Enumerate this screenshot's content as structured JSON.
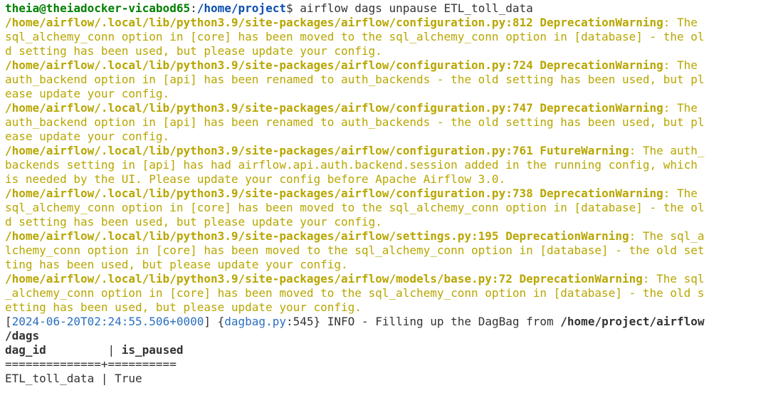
{
  "prompt": {
    "user_host": "theia@theiadocker-vicabod65",
    "sep": ":",
    "path": "/home/project",
    "symbol": "$ ",
    "command": "airflow dags unpause ETL_toll_data"
  },
  "warnings": [
    {
      "first": {
        "path": "/home/airflow/.local/lib/python3.9/site-packages/airflow/configuration.py:812",
        "type": "DeprecationWarning",
        "rest": ": The"
      },
      "lines": [
        "sql_alchemy_conn option in [core] has been moved to the sql_alchemy_conn option in [database] - the ol",
        "d setting has been used, but please update your config."
      ]
    },
    {
      "first": {
        "path": "/home/airflow/.local/lib/python3.9/site-packages/airflow/configuration.py:724",
        "type": "DeprecationWarning",
        "rest": ": The"
      },
      "lines": [
        "auth_backend option in [api] has been renamed to auth_backends - the old setting has been used, but pl",
        "ease update your config."
      ]
    },
    {
      "first": {
        "path": "/home/airflow/.local/lib/python3.9/site-packages/airflow/configuration.py:747",
        "type": "DeprecationWarning",
        "rest": ": The"
      },
      "lines": [
        "auth_backend option in [api] has been renamed to auth_backends - the old setting has been used, but pl",
        "ease update your config."
      ]
    },
    {
      "first": {
        "path": "/home/airflow/.local/lib/python3.9/site-packages/airflow/configuration.py:761",
        "type": "FutureWarning",
        "rest": ": The auth_"
      },
      "lines": [
        "backends setting in [api] has had airflow.api.auth.backend.session added in the running config, which",
        "is needed by the UI. Please update your config before Apache Airflow 3.0."
      ]
    },
    {
      "first": {
        "path": "/home/airflow/.local/lib/python3.9/site-packages/airflow/configuration.py:738",
        "type": "DeprecationWarning",
        "rest": ": The"
      },
      "lines": [
        "sql_alchemy_conn option in [core] has been moved to the sql_alchemy_conn option in [database] - the ol",
        "d setting has been used, but please update your config."
      ]
    },
    {
      "first": {
        "path": "/home/airflow/.local/lib/python3.9/site-packages/airflow/settings.py:195",
        "type": "DeprecationWarning",
        "rest": ": The sql_a"
      },
      "lines": [
        "lchemy_conn option in [core] has been moved to the sql_alchemy_conn option in [database] - the old set",
        "ting has been used, but please update your config."
      ]
    },
    {
      "first": {
        "path": "/home/airflow/.local/lib/python3.9/site-packages/airflow/models/base.py:72",
        "type": "DeprecationWarning",
        "rest": ": The sql"
      },
      "lines": [
        "_alchemy_conn option in [core] has been moved to the sql_alchemy_conn option in [database] - the old s",
        "etting has been used, but please update your config."
      ]
    }
  ],
  "info": {
    "open_bracket": "[",
    "timestamp": "2024-06-20T02:24:55.506+0000",
    "close_bracket": "] ",
    "open_brace": "{",
    "module": "dagbag.py",
    "lineno": ":545",
    "close_brace": "} ",
    "message": "INFO - Filling up the DagBag from ",
    "path_part1": "/home/project/airflow",
    "path_part2": "/dags"
  },
  "table": {
    "col1_header": "dag_id",
    "col_sep": "         | ",
    "col2_header": "is_paused",
    "separator": "==============+==========",
    "row_col1": "ETL_toll_data",
    "row_sep": " | ",
    "row_col2": "True"
  },
  "colors": {
    "prompt_user": "#008000",
    "prompt_path": "#0b4fb0",
    "warning": "#b8a600",
    "text": "#333333",
    "info_link": "#2a6fc0"
  }
}
